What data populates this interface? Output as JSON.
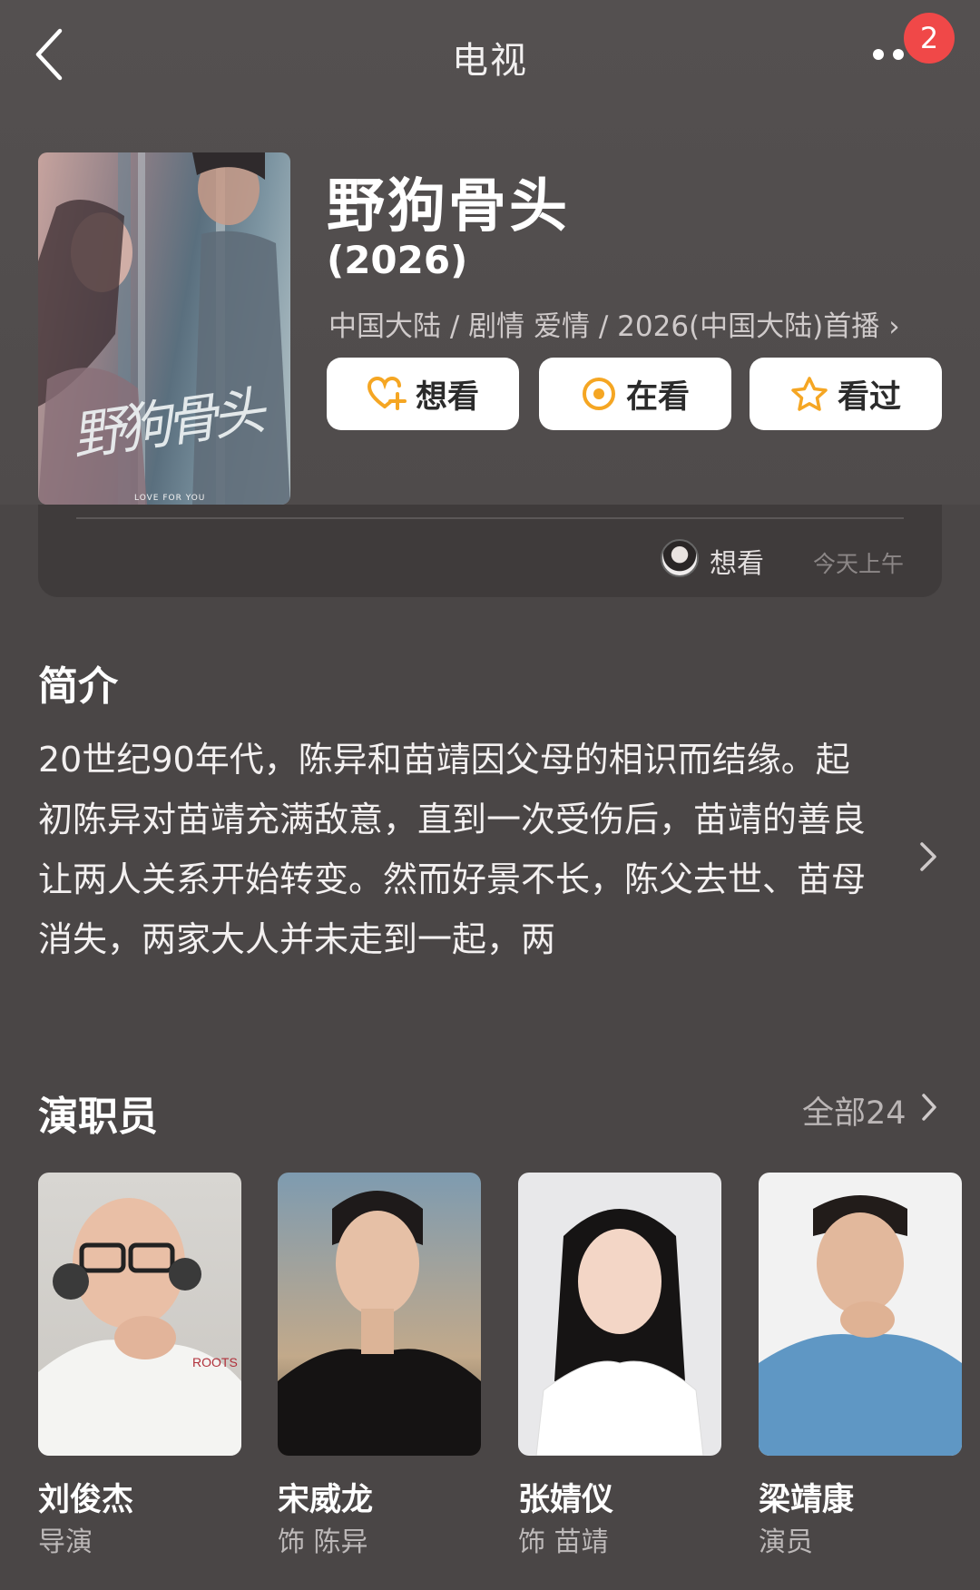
{
  "nav": {
    "title": "电视",
    "notification_count": "2"
  },
  "show": {
    "title": "野狗骨头",
    "year": "(2026)",
    "meta": "中国大陆 / 剧情 爱情 / 2026(中国大陆)首播",
    "poster_text": "野狗骨头",
    "poster_subtitle": "LOVE FOR YOU"
  },
  "actions": {
    "want": "想看",
    "watching": "在看",
    "watched": "看过"
  },
  "activity": {
    "status": "想看",
    "time": "今天上午"
  },
  "synopsis": {
    "heading": "简介",
    "text": "20世纪90年代，陈异和苗靖因父母的相识而结缘。起初陈异对苗靖充满敌意，直到一次受伤后，苗靖的善良让两人关系开始转变。然而好景不长，陈父去世、苗母消失，两家大人并未走到一起，两"
  },
  "cast": {
    "heading": "演职员",
    "all_label": "全部24",
    "members": [
      {
        "name": "刘俊杰",
        "role": "导演"
      },
      {
        "name": "宋威龙",
        "role": "饰 陈异"
      },
      {
        "name": "张婧仪",
        "role": "饰 苗靖"
      },
      {
        "name": "梁靖康",
        "role": "演员"
      }
    ]
  },
  "colors": {
    "background": "#4a4646",
    "card": "#3f3b3b",
    "badge": "#f04848",
    "accent_icon": "#f5a623"
  }
}
